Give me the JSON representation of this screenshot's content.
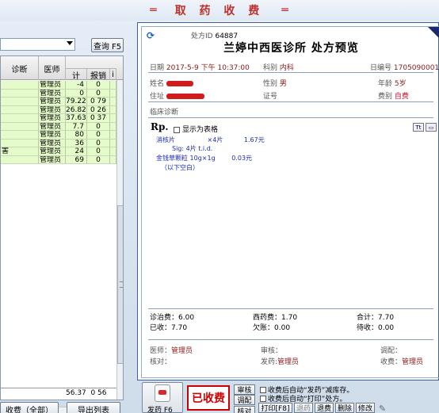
{
  "window": {
    "title": "取 药 收 费",
    "deco_left": "═",
    "deco_right": "═"
  },
  "left": {
    "select_value": "",
    "query_button": "查询 F5",
    "columns": {
      "diagnosis": "诊断",
      "doctor": "医师",
      "amount": "计",
      "refund": "报销",
      "extra": "i"
    },
    "rows": [
      {
        "diagnosis": "",
        "doctor": "管理员",
        "amount": "-4",
        "refund": "0"
      },
      {
        "diagnosis": "",
        "doctor": "管理员",
        "amount": "0",
        "refund": "0"
      },
      {
        "diagnosis": "",
        "doctor": "管理员",
        "amount": "79.22",
        "refund": "0 79"
      },
      {
        "diagnosis": "",
        "doctor": "管理员",
        "amount": "26.82",
        "refund": "0 26"
      },
      {
        "diagnosis": "",
        "doctor": "管理员",
        "amount": "37.63",
        "refund": "0 37"
      },
      {
        "diagnosis": "",
        "doctor": "管理员",
        "amount": "7.7",
        "refund": "0"
      },
      {
        "diagnosis": "",
        "doctor": "管理员",
        "amount": "80",
        "refund": "0"
      },
      {
        "diagnosis": "",
        "doctor": "管理员",
        "amount": "36",
        "refund": "0"
      },
      {
        "diagnosis": "害",
        "doctor": "管理员",
        "amount": "24",
        "refund": "0"
      },
      {
        "diagnosis": "",
        "doctor": "管理员",
        "amount": "69",
        "refund": "0"
      }
    ],
    "footer_total": "56.37",
    "footer_refund": "0 56",
    "button_charge_all": "收费（全部）",
    "button_export": "导出列表"
  },
  "rx": {
    "prescription_id_label": "处方ID",
    "prescription_id": "64887",
    "clinic_title": "兰婷中西医诊所  处方预览",
    "date_label": "日期",
    "date_value": "2017-5-9 下午 10:37:00",
    "dept_label": "科别",
    "dept_value": "内科",
    "number_label": "日编号",
    "number_value": "1705090001",
    "name_label": "姓名",
    "gender_label": "性别",
    "gender_value": "男",
    "age_label": "年龄",
    "age_value": "5岁",
    "address_label": "住址",
    "id_label": "证号",
    "fee_type_label": "费别",
    "fee_type_value": "自费",
    "diagnosis_label": "临床诊断",
    "rp_label": "Rp.",
    "show_table_label": "显示为表格",
    "items": [
      {
        "name": "消核片",
        "qty": "×4片",
        "price": "1.67元",
        "usage": "Sig: 4片 t.i.d."
      },
      {
        "name": "金钱草颗粒  10g×1g",
        "price": "0.03元"
      }
    ],
    "blank_note": "（以下空白）",
    "fees": {
      "consult_fee": "诊治费：6.00",
      "western_fee": "西药费：1.70",
      "total": "合计：7.70",
      "received": "已收：7.70",
      "owed": "欠账：0.00",
      "pending": "待收：0.00"
    },
    "physician_label": "医师：",
    "physician_value": "管理员",
    "review_label": "审核：",
    "mix_label": "调配：",
    "check_label": "核对：",
    "dispense_label": "发药:",
    "dispense_value": "管理员",
    "cashier_label": "收费：",
    "cashier_value": "管理员"
  },
  "bottom": {
    "dispense_button": "发药 F6",
    "paid_badge": "已收费",
    "btn_review": "审核",
    "btn_mix": "调配",
    "btn_check": "核对",
    "opt1": "收费后自动“发药”减库存。",
    "opt2": "收费后自动“打印”处方。",
    "btn_print": "打印[F8]",
    "btn_return": "退药",
    "btn_refund": "退费",
    "btn_delete": "删除",
    "btn_modify": "修改"
  },
  "colors": {
    "row_bg": "#e5fbc9",
    "accent_red": "#c8102e",
    "border_blue": "#3b5fa8",
    "drug_blue": "#1b2ab8"
  }
}
